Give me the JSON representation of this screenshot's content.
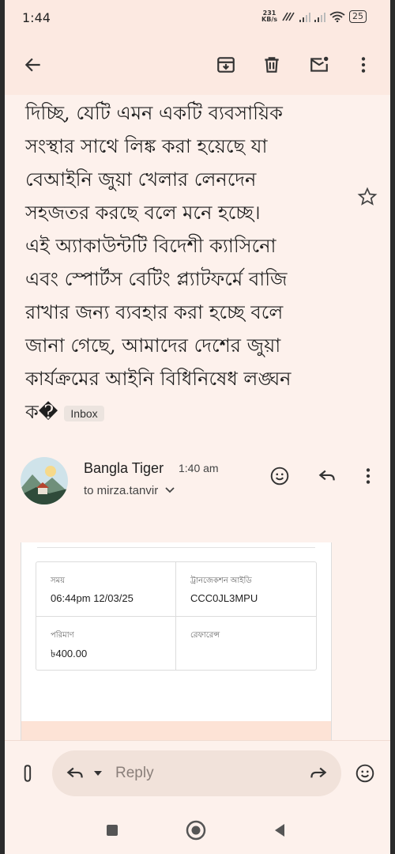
{
  "status_bar": {
    "time": "1:44",
    "net_speed_value": "231",
    "net_speed_unit": "KB/s",
    "battery": "25"
  },
  "toolbar": {
    "back_icon": "arrow-left-icon",
    "archive_icon": "archive-icon",
    "delete_icon": "trash-icon",
    "mark_unread_icon": "mail-unread-icon",
    "more_icon": "more-vert-icon"
  },
  "message": {
    "body_lines": [
      "দিচ্ছি, যেটি এমন একটি ব্যবসায়িক",
      "সংস্থার সাথে লিঙ্ক করা হয়েছে যা",
      "বেআইনি জুয়া খেলার লেনদেন",
      "সহজতর করছে বলে মনে হচ্ছে।",
      "এই অ্যাকাউন্টটি বিদেশী ক্যাসিনো",
      "এবং স্পোর্টস বেটিং প্ল্যাটফর্মে বাজি",
      "রাখার জন্য ব্যবহার করা হচ্ছে বলে",
      "জানা গেছে, আমাদের দেশের জুয়া",
      "কার্যক্রমের আইনি বিধিনিষেধ লঙ্ঘন",
      "ক�"
    ],
    "label_chip": "Inbox"
  },
  "sender": {
    "name": "Bangla Tiger",
    "time": "1:40 am",
    "to": "to mirza.tanvir"
  },
  "receipt": {
    "rows": [
      [
        {
          "label": "সময়",
          "value": "06:44pm 12/03/25"
        },
        {
          "label": "ট্রানজেকশন আইডি",
          "value": "CCC0JL3MPU"
        }
      ],
      [
        {
          "label": "পরিমাণ",
          "value": "৳400.00"
        },
        {
          "label": "রেফারেন্স",
          "value": ""
        }
      ]
    ]
  },
  "reply_bar": {
    "placeholder": "Reply"
  },
  "colors": {
    "background": "#fdf1ec",
    "toolbar": "#fce9e1",
    "pill": "#f1e2da"
  }
}
